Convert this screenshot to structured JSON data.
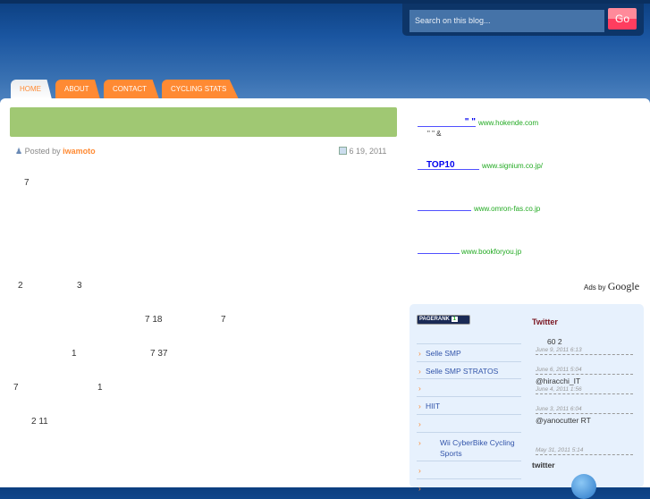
{
  "search": {
    "placeholder": "Search on this blog...",
    "go_label": "Go"
  },
  "nav": {
    "tabs": [
      {
        "label": "HOME"
      },
      {
        "label": "ABOUT"
      },
      {
        "label": "CONTACT"
      },
      {
        "label": "CYCLING STATS"
      }
    ]
  },
  "post": {
    "posted_by": "Posted by",
    "author": "iwamoto",
    "date": "6  19, 2011",
    "fragments": [
      "7",
      "2",
      "3",
      "7 18",
      "7",
      "1",
      "7 37",
      "7",
      "1",
      "2  11"
    ]
  },
  "ads": {
    "items": [
      {
        "title": "\"    \"",
        "url": "www.hokende.com",
        "desc": "\"       \"  &"
      },
      {
        "title": "TOP10",
        "url": "www.signium.co.jp/"
      },
      {
        "title": "",
        "url": "www.omron-fas.co.jp"
      },
      {
        "title": "",
        "url": "www.bookforyou.jp"
      }
    ],
    "ads_by": "Ads by",
    "google": "Google"
  },
  "pagerank": {
    "label": "PAGERANK",
    "value": "1"
  },
  "categories": [
    "Selle SMP",
    "Selle SMP STRATOS",
    "",
    "HIIT",
    "",
    "Wii CyberBike Cycling Sports",
    "",
    ""
  ],
  "twitter": {
    "title": "Twitter",
    "tweets": [
      {
        "text": "60          2",
        "date": "June 9, 2011 6:13"
      },
      {
        "text": "",
        "date": "June 6, 2011 5:04"
      },
      {
        "text": "@hiracchi_IT",
        "date": "June 4, 2011 1:56"
      },
      {
        "text": "",
        "date": "June 3, 2011 6:04"
      },
      {
        "text": "@yanocutter        RT",
        "date": "May 31, 2011 5:14"
      }
    ],
    "footer": "twitter"
  }
}
